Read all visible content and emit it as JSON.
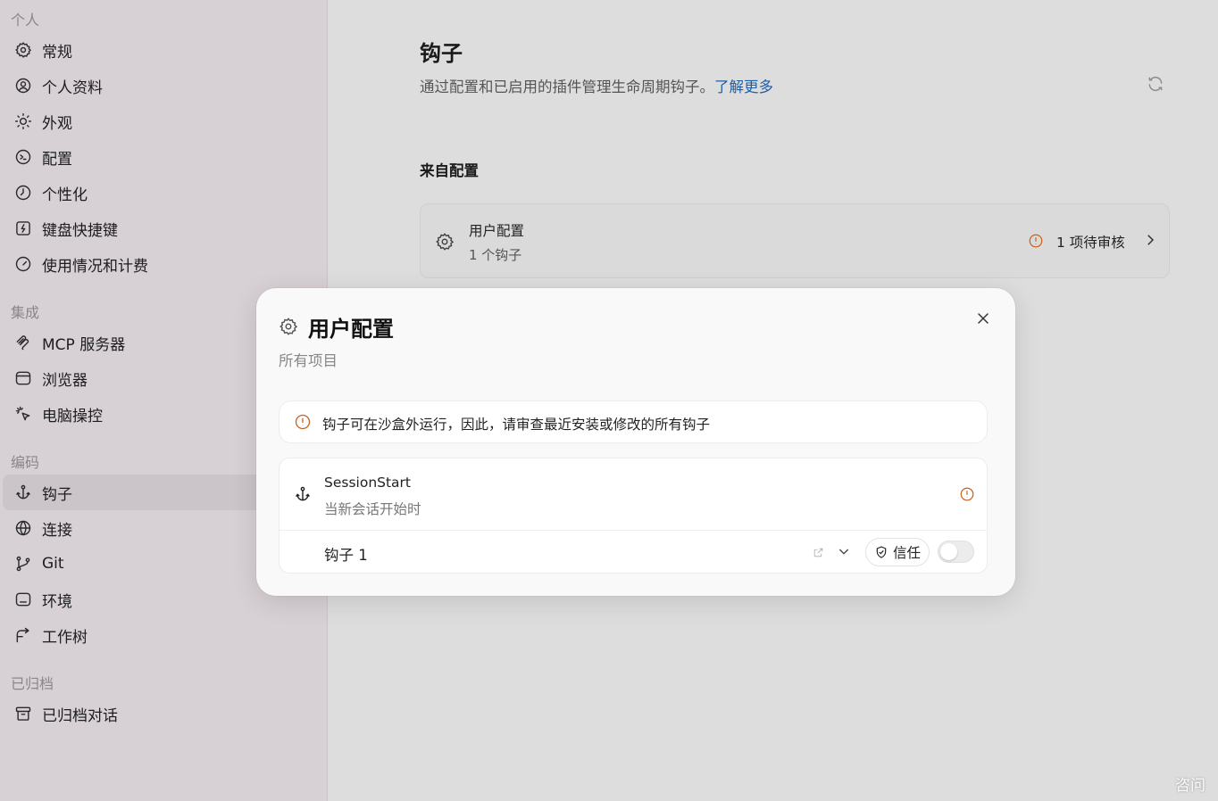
{
  "sidebar": {
    "sections": [
      {
        "label": "个人",
        "items": [
          {
            "label": "常规",
            "icon": "gear-icon"
          },
          {
            "label": "个人资料",
            "icon": "user-circle-icon"
          },
          {
            "label": "外观",
            "icon": "sun-icon"
          },
          {
            "label": "配置",
            "icon": "terminal-icon"
          },
          {
            "label": "个性化",
            "icon": "clock-icon"
          },
          {
            "label": "键盘快捷键",
            "icon": "bolt-icon"
          },
          {
            "label": "使用情况和计费",
            "icon": "gauge-icon"
          }
        ]
      },
      {
        "label": "集成",
        "items": [
          {
            "label": "MCP 服务器",
            "icon": "mcp-icon"
          },
          {
            "label": "浏览器",
            "icon": "browser-icon"
          },
          {
            "label": "电脑操控",
            "icon": "cursor-click-icon"
          }
        ]
      },
      {
        "label": "编码",
        "items": [
          {
            "label": "钩子",
            "icon": "anchor-icon"
          },
          {
            "label": "连接",
            "icon": "globe-icon"
          },
          {
            "label": "Git",
            "icon": "git-branch-icon"
          },
          {
            "label": "环境",
            "icon": "display-icon"
          },
          {
            "label": "工作树",
            "icon": "worktree-icon"
          }
        ]
      },
      {
        "label": "已归档",
        "items": [
          {
            "label": "已归档对话",
            "icon": "archive-icon"
          }
        ]
      }
    ],
    "active": "钩子"
  },
  "main": {
    "title": "钩子",
    "description": "通过配置和已启用的插件管理生命周期钩子。",
    "learn_more": "了解更多",
    "section_heading": "来自配置",
    "config_card": {
      "title": "用户配置",
      "subtitle": "1 个钩子",
      "review": "1 项待审核"
    }
  },
  "modal": {
    "title": "用户配置",
    "subtitle": "所有项目",
    "warning": "钩子可在沙盒外运行，因此，请审查最近安装或修改的所有钩子",
    "hook_event": "SessionStart",
    "hook_event_desc": "当新会话开始时",
    "hook_name": "钩子 1",
    "trust_label": "信任",
    "toggle_on": false
  },
  "footer": {
    "help": "咨问"
  },
  "colors": {
    "link": "#1f5fa6",
    "warning": "#c9601e",
    "sidebar_bg": "#d7d0d4"
  }
}
